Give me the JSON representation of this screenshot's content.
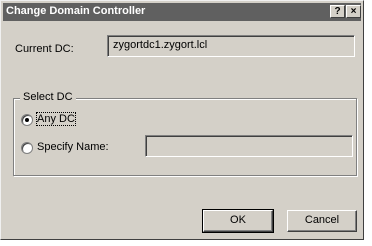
{
  "dialog": {
    "title": "Change Domain Controller",
    "help_button": "?",
    "close_button": "×"
  },
  "current_dc": {
    "label": "Current DC:",
    "value": "zygortdc1.zygort.lcl"
  },
  "select_dc": {
    "group_label": "Select DC",
    "options": [
      {
        "label": "Any DC",
        "selected": true
      },
      {
        "label": "Specify Name:",
        "selected": false
      }
    ],
    "name_input_value": ""
  },
  "buttons": {
    "ok": "OK",
    "cancel": "Cancel"
  },
  "colors": {
    "titlebar": "#606060",
    "dialog_face": "#d4d0c8"
  }
}
